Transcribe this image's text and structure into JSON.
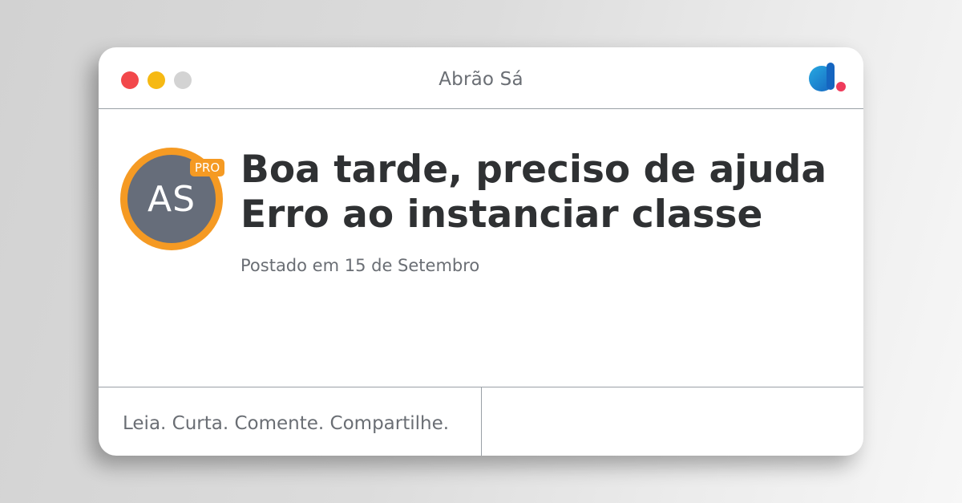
{
  "window": {
    "title": "Abrão Sá",
    "logo_icon": "brand-logo-icon",
    "controls": {
      "close_color": "#f2484b",
      "minimize_color": "#f6b913",
      "maximize_color": "#d3d3d3"
    }
  },
  "post": {
    "author_initials": "AS",
    "badge": "PRO",
    "title_lines": [
      "Boa tarde, preciso de ajuda",
      "Erro ao instanciar classe"
    ],
    "posted": "Postado em 15 de Setembro"
  },
  "footer": {
    "tagline": "Leia. Curta. Comente. Compartilhe."
  },
  "colors": {
    "accent": "#f59a23",
    "avatar_bg": "#666d7a",
    "text_primary": "#2f3133",
    "text_secondary": "#6a6e74"
  }
}
